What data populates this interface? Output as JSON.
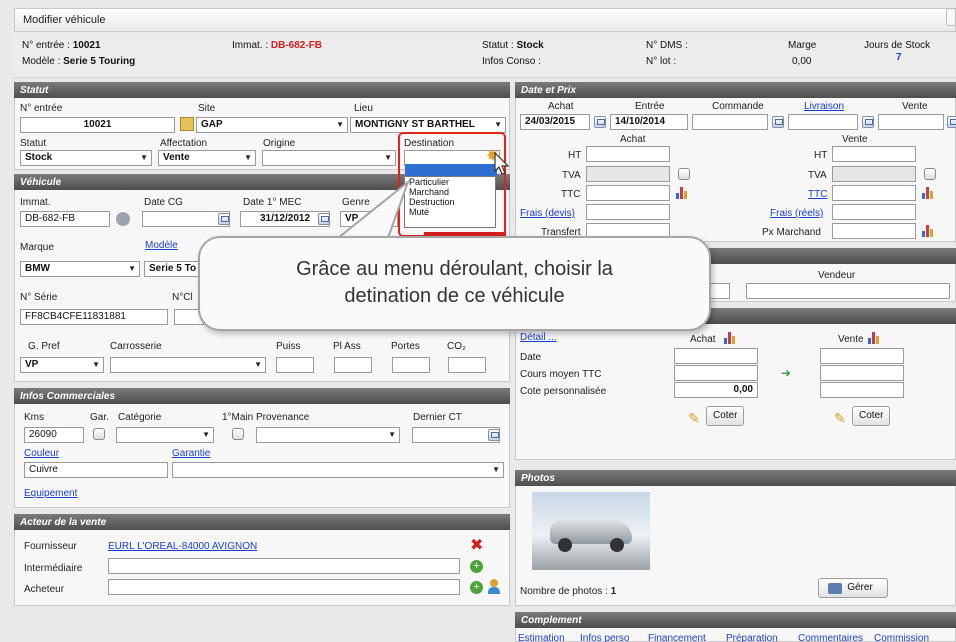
{
  "window": {
    "title": "Modifier véhicule"
  },
  "info": {
    "entree_label": "N° entrée :",
    "entree": "10021",
    "immat_label": "Immat. :",
    "immat": "DB-682-FB",
    "statut_label": "Statut :",
    "statut": "Stock",
    "dms_label": "N° DMS :",
    "marge_label": "Marge",
    "marge": "0,00",
    "jours_label": "Jours de Stock",
    "jours": "7",
    "modele_label": "Modèle :",
    "modele": "Serie 5 Touring",
    "conso_label": "Infos Conso :",
    "lot_label": "N° lot :"
  },
  "statut": {
    "title": "Statut",
    "entree_label": "N° entrée",
    "entree": "10021",
    "site_label": "Site",
    "site": "GAP",
    "lieu_label": "Lieu",
    "lieu": "MONTIGNY ST BARTHEL",
    "statut_label": "Statut",
    "statut": "Stock",
    "affectation_label": "Affectation",
    "affectation": "Vente",
    "origine_label": "Origine",
    "destination_label": "Destination",
    "destination_options": [
      "Particulier",
      "Marchand",
      "Destruction",
      "Muté"
    ]
  },
  "vehicule": {
    "title": "Véhicule",
    "immat_label": "Immat.",
    "immat": "DB-682-FB",
    "datecg_label": "Date CG",
    "mec_label": "Date 1° MEC",
    "mec": "31/12/2012",
    "genre_label": "Genre",
    "genre": "VP",
    "marque_label": "Marque",
    "marque": "BMW",
    "modele_link": "Modèle",
    "modele": "Serie 5 To",
    "serie_label": "N° Série",
    "serie": "FF8CB4CFE11831881",
    "ncl_label": "N°Cl",
    "gpref_label": "G. Pref",
    "gpref": "VP",
    "carrosserie_label": "Carrosserie",
    "puiss_label": "Puiss",
    "plass_label": "Pl Ass",
    "portes_label": "Portes",
    "co2_label": "CO₂"
  },
  "commercial": {
    "title": "Infos Commerciales",
    "kms_label": "Kms",
    "kms": "26090",
    "gar_label": "Gar.",
    "categorie_label": "Catégorie",
    "main_label": "1°Main",
    "provenance_label": "Provenance",
    "ct_label": "Dernier CT",
    "couleur_link": "Couleur",
    "couleur": "Cuivre",
    "garantie_link": "Garantie",
    "equipement_link": "Equipement"
  },
  "acteur": {
    "title": "Acteur de la vente",
    "fournisseur_label": "Fournisseur",
    "fournisseur": "EURL L'OREAL-84000 AVIGNON",
    "intermediaire_label": "Intermédiaire",
    "acheteur_label": "Acheteur"
  },
  "prix": {
    "title": "Date et Prix",
    "achat_label": "Achat",
    "entree_label": "Entrée",
    "commande_label": "Commande",
    "livraison_link": "Livraison",
    "vente_label": "Vente",
    "achat_date": "24/03/2015",
    "entree_date": "14/10/2014",
    "col_achat": "Achat",
    "col_vente": "Vente",
    "ht": "HT",
    "tva": "TVA",
    "ttc": "TTC",
    "ttc_link": "TTC",
    "frais_devis": "Frais (devis)",
    "frais_reels": "Frais (réels)",
    "transfert": "Transfert",
    "px_marchand": "Px Marchand"
  },
  "vendeur": {
    "label": "Vendeur"
  },
  "cote": {
    "detail_link": "Détail ...",
    "achat_label": "Achat",
    "vente_label": "Vente",
    "date_label": "Date",
    "cours_label": "Cours moyen TTC",
    "perso_label": "Cote personnalisée",
    "perso_value": "0,00",
    "coter_btn": "Coter"
  },
  "photos": {
    "title": "Photos",
    "count_label": "Nombre de photos :",
    "count": "1",
    "gerer_btn": "Gérer"
  },
  "complement": {
    "title": "Complement",
    "tabs": [
      "Estimation",
      "Infos perso",
      "Financement",
      "Préparation",
      "Commentaires",
      "Commission"
    ]
  },
  "callout": {
    "line1": "Grâce au menu déroulant, choisir la",
    "line2": "detination de ce véhicule"
  }
}
